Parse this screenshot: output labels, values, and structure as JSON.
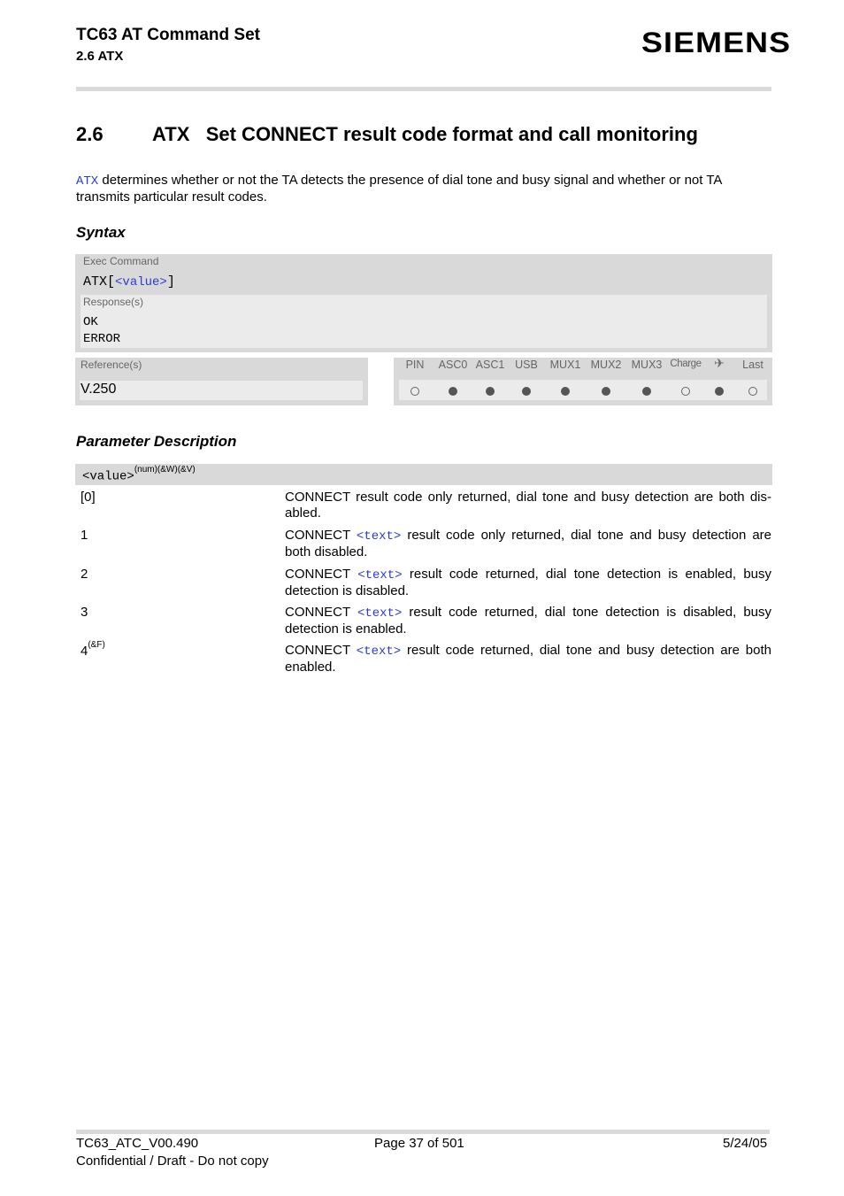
{
  "header": {
    "title": "TC63 AT Command Set",
    "subtitle": "2.6 ATX",
    "logo": "SIEMENS"
  },
  "section": {
    "number": "2.6",
    "title": "ATX   Set CONNECT result code format and call monitoring"
  },
  "intro": {
    "link": "ATX",
    "text": " determines whether or not the TA detects the presence of dial tone and busy signal and whether or not TA transmits particular result codes."
  },
  "syntax": {
    "heading": "Syntax",
    "exec_label": "Exec Command",
    "exec_cmd_prefix": "ATX[",
    "exec_cmd_param": "<value>",
    "exec_cmd_suffix": "]",
    "response_label": "Response(s)",
    "responses": [
      "OK",
      "ERROR"
    ],
    "reference_label": "Reference(s)",
    "reference_value": "V.250",
    "flags": [
      {
        "label": "PIN",
        "supported": false
      },
      {
        "label": "ASC0",
        "supported": true
      },
      {
        "label": "ASC1",
        "supported": true
      },
      {
        "label": "USB",
        "supported": true
      },
      {
        "label": "MUX1",
        "supported": true
      },
      {
        "label": "MUX2",
        "supported": true
      },
      {
        "label": "MUX3",
        "supported": true
      },
      {
        "label": "Charge",
        "supported": false
      },
      {
        "label": "✈",
        "supported": true
      },
      {
        "label": "Last",
        "supported": false
      }
    ]
  },
  "params": {
    "heading": "Parameter Description",
    "name": "<value>",
    "name_sup": "(num)(&W)(&V)",
    "values": [
      {
        "value": "[0]",
        "sup": "",
        "pre": "CONNECT result code only returned, dial tone and busy detection are both dis-abled.",
        "link": "",
        "post": ""
      },
      {
        "value": "1",
        "sup": "",
        "pre": "CONNECT ",
        "link": "<text>",
        "post": " result code only returned, dial tone and busy detection are both disabled."
      },
      {
        "value": "2",
        "sup": "",
        "pre": "CONNECT ",
        "link": "<text>",
        "post": " result code returned, dial tone detection is enabled, busy detection is disabled."
      },
      {
        "value": "3",
        "sup": "",
        "pre": "CONNECT ",
        "link": "<text>",
        "post": " result code returned, dial tone detection is disabled, busy detection is enabled."
      },
      {
        "value": "4",
        "sup": "(&F)",
        "pre": "CONNECT ",
        "link": "<text>",
        "post": " result code returned, dial tone and busy detection are both enabled."
      }
    ]
  },
  "footer": {
    "doc_id": "TC63_ATC_V00.490",
    "confidential": "Confidential / Draft - Do not copy",
    "page": "Page 37 of 501",
    "date": "5/24/05"
  }
}
